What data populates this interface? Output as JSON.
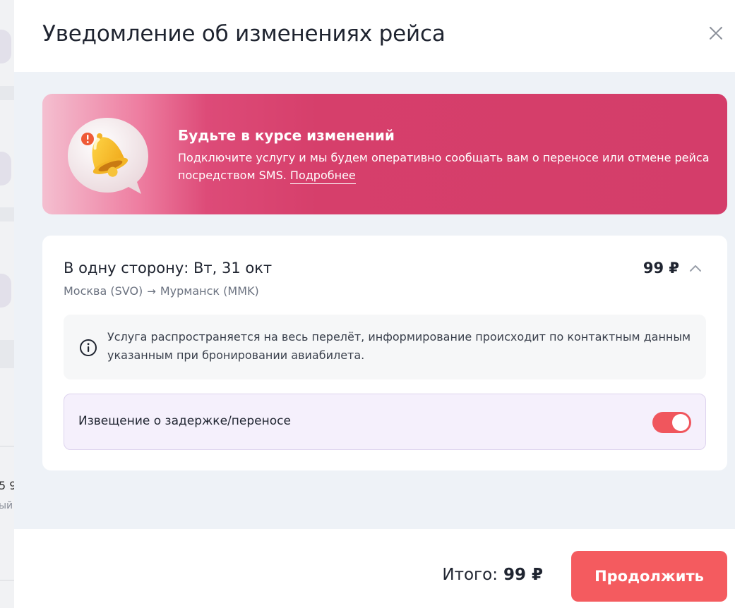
{
  "background_page": {
    "price_fragment": "5 9",
    "label_fragment": "ый"
  },
  "modal": {
    "title": "Уведомление об изменениях рейса",
    "close_icon": "close-icon"
  },
  "banner": {
    "title": "Будьте в курсе изменений",
    "text": "Подключите услугу и мы будем оперативно сообщать вам о переносе или отмене рейса посредством SMS.",
    "link": "Подробнее",
    "icon": "bell-icon",
    "colors": {
      "from": "#f4bfd0",
      "to": "#d43d6a"
    }
  },
  "segment": {
    "title": "В одну сторону: Вт, 31 окт",
    "price": "99 ₽",
    "origin": "Москва (SVO)",
    "arrow": "→",
    "destination": "Мурманск (MMK)",
    "expanded": true
  },
  "info": {
    "icon": "info-icon",
    "text": "Услуга распространяется на весь перелёт, информирование происходит по контактным данным указанным при бронировании авиабилета."
  },
  "option": {
    "label": "Извещение о задержке/переносе",
    "enabled": true,
    "toggle_color": "#f0565d"
  },
  "footer": {
    "total_label": "Итого:",
    "total_amount": "99 ₽",
    "continue_label": "Продолжить",
    "button_color": "#f45b5f"
  }
}
